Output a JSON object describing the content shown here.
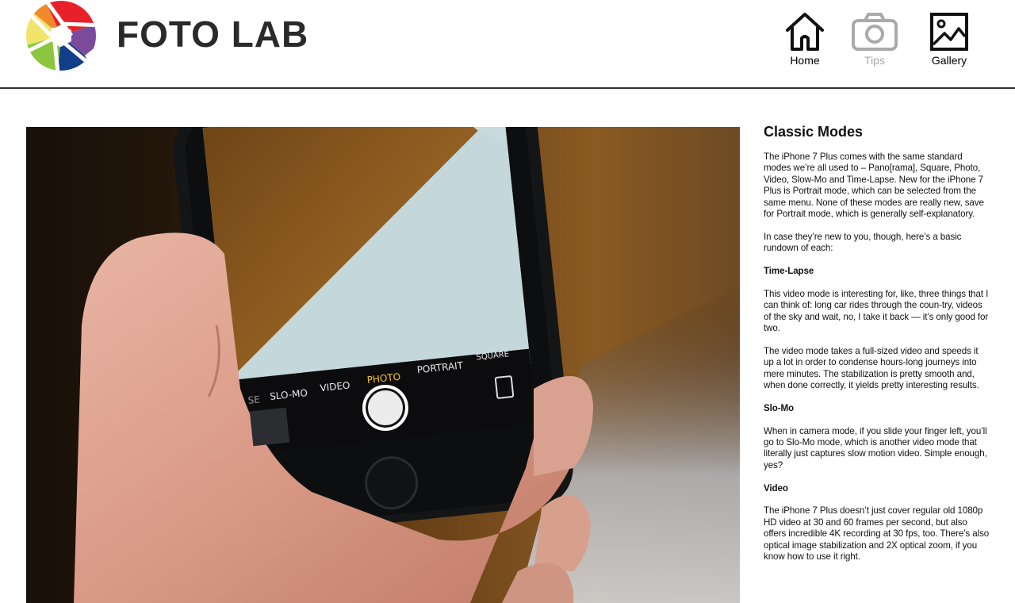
{
  "header": {
    "brand": "FOTO LAB",
    "nav": [
      {
        "label": "Home",
        "icon": "home-icon"
      },
      {
        "label": "Tips",
        "icon": "camera-icon"
      },
      {
        "label": "Gallery",
        "icon": "image-icon"
      }
    ]
  },
  "colors": {
    "aperture_red": "#e8202a",
    "aperture_orange": "#f08a2c",
    "aperture_yellow": "#f1e46a",
    "aperture_green": "#8cc63f",
    "aperture_blue": "#123e8a",
    "aperture_purple": "#7b4a9a",
    "tips_inactive": "#aaaaaa"
  },
  "hero": {
    "screen_labels": [
      "SE",
      "SLO-MO",
      "VIDEO",
      "PHOTO",
      "PORTRAIT",
      "SQUARE"
    ]
  },
  "article": {
    "title": "Classic Modes",
    "p1": "The iPhone 7 Plus comes with the same standard modes we’re all used to – Pano[rama], Square, Photo, Video, Slow-Mo and Time-Lapse. New for the iPhone 7 Plus is Portrait mode, which can be selected from the same menu. None of these modes are really new, save for Portrait mode, which is generally self-explanatory.",
    "p2": "In case they’re new to you, though, here’s a basic rundown of each:",
    "h_timelapse": "Time-Lapse",
    "p3": "This video mode is interesting for, like, three things that I can think of: long car rides through the coun-try, videos of the sky and wait, no, I take it back — it’s only good for two.",
    "p4": "The video mode takes a full-sized video and speeds it up a lot in order to condense hours-long journeys into mere minutes. The stabilization is pretty smooth and, when done correctly, it yields pretty interesting results.",
    "h_slomo": "Slo-Mo",
    "p5": "When in camera mode, if you slide your finger left, you’ll go to Slo-Mo mode, which is another video mode that literally just captures slow motion video. Simple enough, yes?",
    "h_video": "Video",
    "p6": "The iPhone 7 Plus doesn’t just cover regular old 1080p HD video at 30 and 60 frames per second, but also offers incredible 4K recording at 30 fps, too. There’s also optical image stabilization and 2X optical zoom, if you know how to use it right."
  }
}
